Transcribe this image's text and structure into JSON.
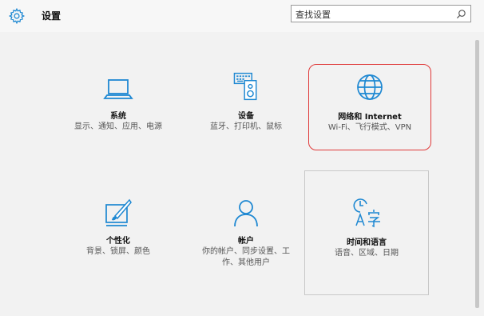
{
  "window": {
    "title": "设置",
    "accent_color": "#1e88d2",
    "highlight_color": "#e03a3a"
  },
  "search": {
    "placeholder": "查找设置",
    "icon": "search-icon"
  },
  "tiles": [
    {
      "id": "system",
      "icon": "laptop-icon",
      "title": "系统",
      "description": "显示、通知、应用、电源"
    },
    {
      "id": "devices",
      "icon": "keyboard-device-icon",
      "title": "设备",
      "description": "蓝牙、打印机、鼠标"
    },
    {
      "id": "network",
      "icon": "globe-icon",
      "title": "网络和 Internet",
      "description": "Wi-Fi、飞行模式、VPN",
      "highlighted": true
    },
    {
      "id": "personalization",
      "icon": "paintbrush-screen-icon",
      "title": "个性化",
      "description": "背景、锁屏、颜色"
    },
    {
      "id": "accounts",
      "icon": "person-icon",
      "title": "帐户",
      "description": "你的帐户、同步设置、工作、其他用户"
    },
    {
      "id": "time-language",
      "icon": "clock-language-icon",
      "title": "时间和语言",
      "description": "语音、区域、日期",
      "focused": true
    }
  ]
}
